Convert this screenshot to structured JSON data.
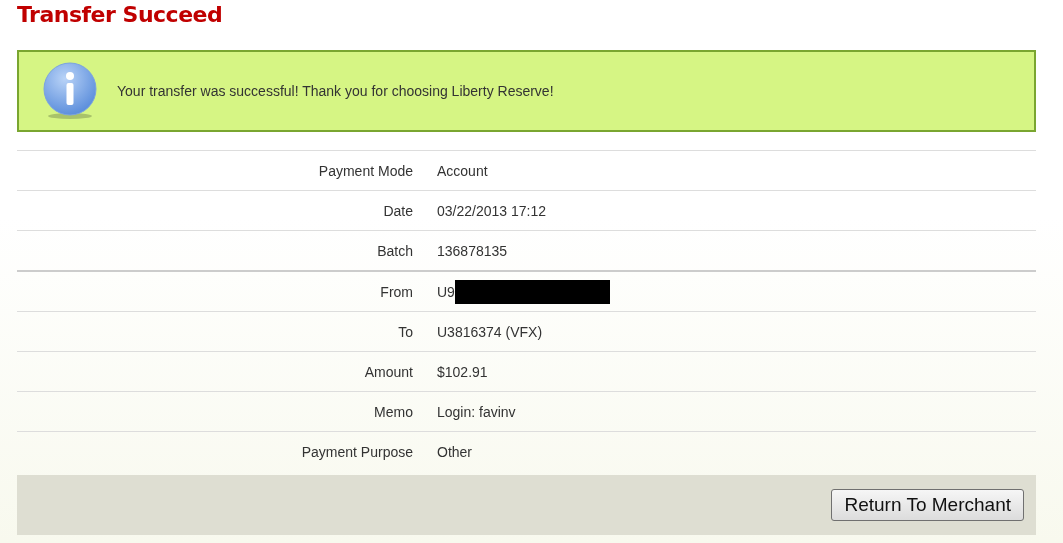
{
  "title": "Transfer Succeed",
  "notice": {
    "message": "Your transfer was successful! Thank you for choosing Liberty Reserve!"
  },
  "details": [
    {
      "label": "Payment Mode",
      "value": "Account",
      "redacted": false
    },
    {
      "label": "Date",
      "value": "03/22/2013 17:12",
      "redacted": false
    },
    {
      "label": "Batch",
      "value": "136878135",
      "redacted": false
    },
    {
      "label": "From",
      "value": "U9",
      "redacted": true
    },
    {
      "label": "To",
      "value": "U3816374 (VFX)",
      "redacted": false
    },
    {
      "label": "Amount",
      "value": "$102.91",
      "redacted": false
    },
    {
      "label": "Memo",
      "value": "Login: favinv",
      "redacted": false
    },
    {
      "label": "Payment Purpose",
      "value": "Other",
      "redacted": false
    }
  ],
  "footer": {
    "button": "Return To Merchant"
  }
}
